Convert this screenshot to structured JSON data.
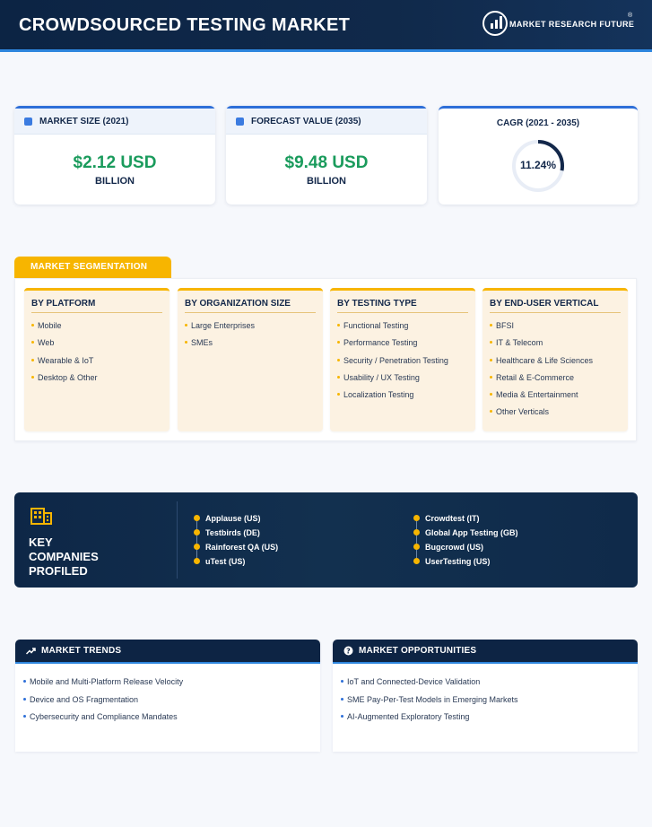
{
  "header": {
    "title": "CROWDSOURCED TESTING MARKET",
    "logo_text": "MARKET RESEARCH FUTURE",
    "logo_mark": "®",
    "logo_icon": "bar-chart-magnifier-icon"
  },
  "kpis": {
    "market_size": {
      "label": "MARKET SIZE (2021)",
      "value": "$2.12 USD",
      "unit": "BILLION",
      "icon": "chart-icon"
    },
    "forecast": {
      "label": "FORECAST VALUE (2035)",
      "value": "$9.48 USD",
      "unit": "BILLION",
      "icon": "chart-icon"
    },
    "cagr": {
      "label": "CAGR (2021 - 2035)",
      "value": "11.24%",
      "gauge_fraction": 0.28
    }
  },
  "segmentation": {
    "tab_label": "MARKET SEGMENTATION",
    "columns": [
      {
        "title": "BY PLATFORM",
        "items": [
          "Mobile",
          "Web",
          "Wearable & IoT",
          "Desktop & Other"
        ]
      },
      {
        "title": "BY ORGANIZATION SIZE",
        "items": [
          "Large Enterprises",
          "SMEs"
        ]
      },
      {
        "title": "BY TESTING TYPE",
        "items": [
          "Functional Testing",
          "Performance Testing",
          "Security / Penetration Testing",
          "Usability / UX Testing",
          "Localization Testing"
        ]
      },
      {
        "title": "BY END-USER VERTICAL",
        "items": [
          "BFSI",
          "IT & Telecom",
          "Healthcare & Life Sciences",
          "Retail & E-Commerce",
          "Media & Entertainment",
          "Other Verticals"
        ]
      }
    ]
  },
  "companies": {
    "title_line1": "KEY",
    "title_line2": "COMPANIES",
    "title_line3": "PROFILED",
    "icon": "building-icon",
    "left": [
      "Applause (US)",
      "Testbirds (DE)",
      "Rainforest QA (US)",
      "uTest (US)"
    ],
    "right": [
      "Crowdtest (IT)",
      "Global App Testing (GB)",
      "Bugcrowd (US)",
      "UserTesting (US)"
    ]
  },
  "trends": {
    "label": "MARKET TRENDS",
    "icon": "trending-up-icon",
    "items": [
      "Mobile and Multi-Platform Release Velocity",
      "Device and OS Fragmentation",
      "Cybersecurity and Compliance Mandates"
    ]
  },
  "opportunities": {
    "label": "MARKET OPPORTUNITIES",
    "icon": "question-circle-icon",
    "items": [
      "IoT and Connected-Device Validation",
      "SME Pay-Per-Test Models in Emerging Markets",
      "AI-Augmented Exploratory Testing"
    ]
  },
  "colors": {
    "header_bg": "#0c2444",
    "accent_blue": "#2e86de",
    "accent_yellow": "#f7b500",
    "value_green": "#1a9b5c"
  }
}
